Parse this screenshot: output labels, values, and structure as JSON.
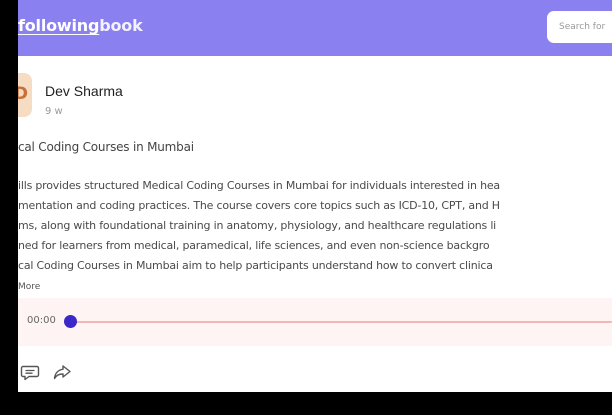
{
  "header": {
    "brand_part1": "following",
    "brand_part2": "book",
    "search_placeholder": "Search for"
  },
  "post": {
    "avatar_initial": "D",
    "author": "Dev Sharma",
    "time": "9 w",
    "title": "cal Coding Courses in Mumbai",
    "body_lines": [
      "ills provides structured Medical Coding Courses in Mumbai for individuals interested in hea",
      "mentation and coding practices. The course covers core topics such as ICD-10, CPT, and H",
      "ms, along with foundational training in anatomy, physiology, and healthcare regulations li",
      "ned for learners from medical, paramedical, life sciences, and even non-science backgro",
      "cal Coding Courses in Mumbai aim to help participants understand how to convert clinica"
    ],
    "more_label": "More"
  },
  "player": {
    "current_time": "00:00",
    "progress": 0
  },
  "icons": {
    "comment": "comment-icon",
    "share": "share-icon"
  },
  "colors": {
    "header_bg": "#8b80f0",
    "player_bg": "#fff4f4",
    "thumb": "#3b28c8",
    "track": "#f3b6b6"
  }
}
